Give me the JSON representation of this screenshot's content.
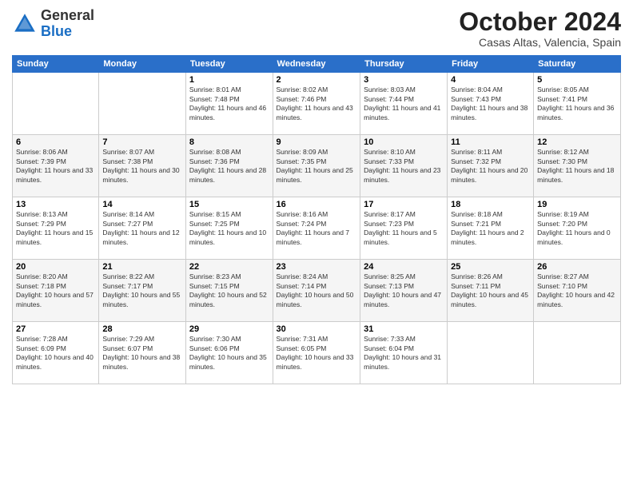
{
  "header": {
    "logo": {
      "general": "General",
      "blue": "Blue"
    },
    "title": "October 2024",
    "location": "Casas Altas, Valencia, Spain"
  },
  "weekdays": [
    "Sunday",
    "Monday",
    "Tuesday",
    "Wednesday",
    "Thursday",
    "Friday",
    "Saturday"
  ],
  "weeks": [
    [
      {
        "day": "",
        "info": ""
      },
      {
        "day": "",
        "info": ""
      },
      {
        "day": "1",
        "info": "Sunrise: 8:01 AM\nSunset: 7:48 PM\nDaylight: 11 hours and 46 minutes."
      },
      {
        "day": "2",
        "info": "Sunrise: 8:02 AM\nSunset: 7:46 PM\nDaylight: 11 hours and 43 minutes."
      },
      {
        "day": "3",
        "info": "Sunrise: 8:03 AM\nSunset: 7:44 PM\nDaylight: 11 hours and 41 minutes."
      },
      {
        "day": "4",
        "info": "Sunrise: 8:04 AM\nSunset: 7:43 PM\nDaylight: 11 hours and 38 minutes."
      },
      {
        "day": "5",
        "info": "Sunrise: 8:05 AM\nSunset: 7:41 PM\nDaylight: 11 hours and 36 minutes."
      }
    ],
    [
      {
        "day": "6",
        "info": "Sunrise: 8:06 AM\nSunset: 7:39 PM\nDaylight: 11 hours and 33 minutes."
      },
      {
        "day": "7",
        "info": "Sunrise: 8:07 AM\nSunset: 7:38 PM\nDaylight: 11 hours and 30 minutes."
      },
      {
        "day": "8",
        "info": "Sunrise: 8:08 AM\nSunset: 7:36 PM\nDaylight: 11 hours and 28 minutes."
      },
      {
        "day": "9",
        "info": "Sunrise: 8:09 AM\nSunset: 7:35 PM\nDaylight: 11 hours and 25 minutes."
      },
      {
        "day": "10",
        "info": "Sunrise: 8:10 AM\nSunset: 7:33 PM\nDaylight: 11 hours and 23 minutes."
      },
      {
        "day": "11",
        "info": "Sunrise: 8:11 AM\nSunset: 7:32 PM\nDaylight: 11 hours and 20 minutes."
      },
      {
        "day": "12",
        "info": "Sunrise: 8:12 AM\nSunset: 7:30 PM\nDaylight: 11 hours and 18 minutes."
      }
    ],
    [
      {
        "day": "13",
        "info": "Sunrise: 8:13 AM\nSunset: 7:29 PM\nDaylight: 11 hours and 15 minutes."
      },
      {
        "day": "14",
        "info": "Sunrise: 8:14 AM\nSunset: 7:27 PM\nDaylight: 11 hours and 12 minutes."
      },
      {
        "day": "15",
        "info": "Sunrise: 8:15 AM\nSunset: 7:25 PM\nDaylight: 11 hours and 10 minutes."
      },
      {
        "day": "16",
        "info": "Sunrise: 8:16 AM\nSunset: 7:24 PM\nDaylight: 11 hours and 7 minutes."
      },
      {
        "day": "17",
        "info": "Sunrise: 8:17 AM\nSunset: 7:23 PM\nDaylight: 11 hours and 5 minutes."
      },
      {
        "day": "18",
        "info": "Sunrise: 8:18 AM\nSunset: 7:21 PM\nDaylight: 11 hours and 2 minutes."
      },
      {
        "day": "19",
        "info": "Sunrise: 8:19 AM\nSunset: 7:20 PM\nDaylight: 11 hours and 0 minutes."
      }
    ],
    [
      {
        "day": "20",
        "info": "Sunrise: 8:20 AM\nSunset: 7:18 PM\nDaylight: 10 hours and 57 minutes."
      },
      {
        "day": "21",
        "info": "Sunrise: 8:22 AM\nSunset: 7:17 PM\nDaylight: 10 hours and 55 minutes."
      },
      {
        "day": "22",
        "info": "Sunrise: 8:23 AM\nSunset: 7:15 PM\nDaylight: 10 hours and 52 minutes."
      },
      {
        "day": "23",
        "info": "Sunrise: 8:24 AM\nSunset: 7:14 PM\nDaylight: 10 hours and 50 minutes."
      },
      {
        "day": "24",
        "info": "Sunrise: 8:25 AM\nSunset: 7:13 PM\nDaylight: 10 hours and 47 minutes."
      },
      {
        "day": "25",
        "info": "Sunrise: 8:26 AM\nSunset: 7:11 PM\nDaylight: 10 hours and 45 minutes."
      },
      {
        "day": "26",
        "info": "Sunrise: 8:27 AM\nSunset: 7:10 PM\nDaylight: 10 hours and 42 minutes."
      }
    ],
    [
      {
        "day": "27",
        "info": "Sunrise: 7:28 AM\nSunset: 6:09 PM\nDaylight: 10 hours and 40 minutes."
      },
      {
        "day": "28",
        "info": "Sunrise: 7:29 AM\nSunset: 6:07 PM\nDaylight: 10 hours and 38 minutes."
      },
      {
        "day": "29",
        "info": "Sunrise: 7:30 AM\nSunset: 6:06 PM\nDaylight: 10 hours and 35 minutes."
      },
      {
        "day": "30",
        "info": "Sunrise: 7:31 AM\nSunset: 6:05 PM\nDaylight: 10 hours and 33 minutes."
      },
      {
        "day": "31",
        "info": "Sunrise: 7:33 AM\nSunset: 6:04 PM\nDaylight: 10 hours and 31 minutes."
      },
      {
        "day": "",
        "info": ""
      },
      {
        "day": "",
        "info": ""
      }
    ]
  ]
}
